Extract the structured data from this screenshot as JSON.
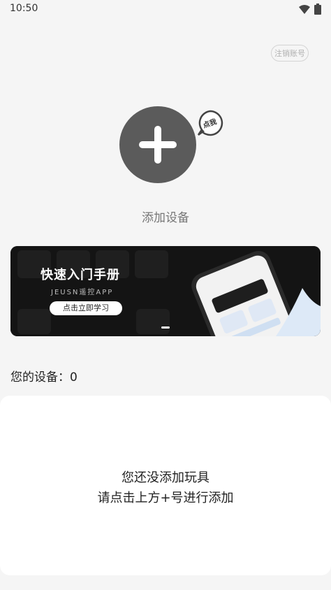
{
  "status_bar": {
    "time": "10:50"
  },
  "header": {
    "logout_label": "注销账号"
  },
  "add_device": {
    "badge_text": "点我",
    "label": "添加设备"
  },
  "banner": {
    "title": "快速入门手册",
    "subtitle": "JEUSN遥控APP",
    "cta": "点击立即学习"
  },
  "devices": {
    "count_label": "您的设备：0"
  },
  "empty_state": {
    "line1": "您还没添加玩具",
    "line2": "请点击上方+号进行添加"
  },
  "colors": {
    "background": "#f5f5f5",
    "add_circle": "#5b5b5b",
    "card": "#ffffff",
    "banner_bg": "#141414"
  }
}
